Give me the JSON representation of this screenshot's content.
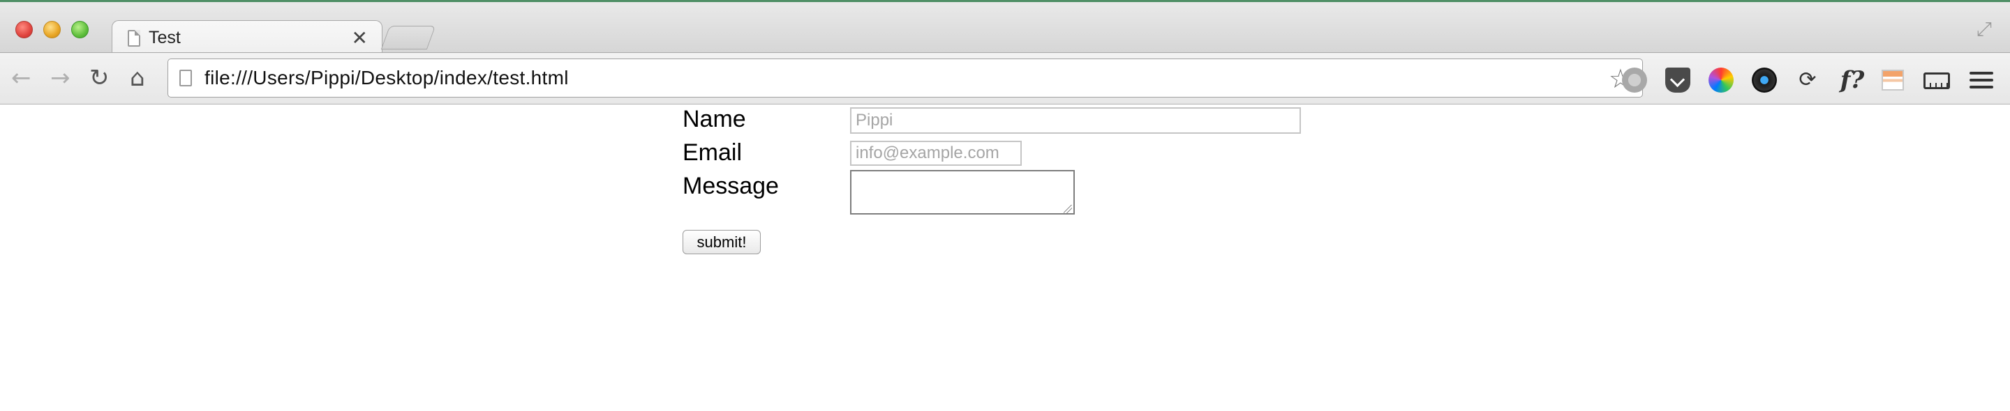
{
  "browser": {
    "tab": {
      "title": "Test",
      "close_glyph": "✕"
    },
    "toolbar": {
      "back_glyph": "←",
      "forward_glyph": "→",
      "reload_glyph": "↻",
      "home_glyph": "⌂"
    },
    "omnibox": {
      "url": "file:///Users/Pippi/Desktop/index/test.html",
      "star_glyph": "☆"
    },
    "extensions": [
      {
        "icon": "grey-disc-extension-icon"
      },
      {
        "icon": "pocket-icon"
      },
      {
        "icon": "color-wheel-icon"
      },
      {
        "icon": "dark-circle-extension-icon"
      },
      {
        "icon": "sync-arrows-icon",
        "glyph": "⟳"
      },
      {
        "icon": "whatfont-icon",
        "glyph": "f?"
      },
      {
        "icon": "window-resizer-icon"
      },
      {
        "icon": "ruler-icon"
      },
      {
        "icon": "chrome-menu-icon"
      }
    ]
  },
  "form": {
    "name_label": "Name",
    "name_placeholder": "Pippi",
    "email_label": "Email",
    "email_placeholder": "info@example.com",
    "message_label": "Message",
    "message_value": "",
    "submit_label": "submit!"
  }
}
